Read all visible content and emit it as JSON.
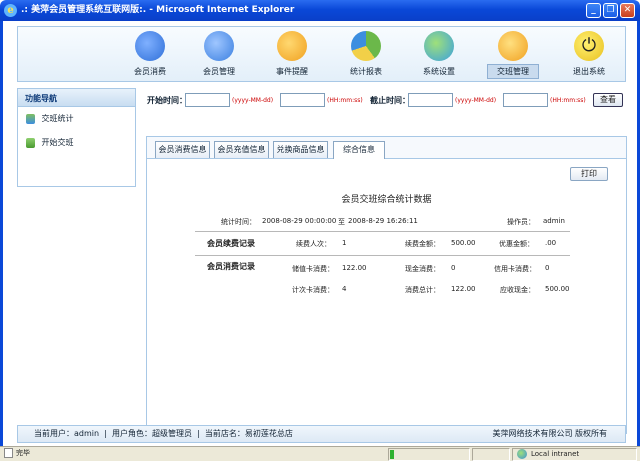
{
  "window": {
    "title": ".: 美萍会员管理系统互联网版:. - Microsoft Internet Explorer",
    "minimize": "_",
    "restore": "❐",
    "close": "✕"
  },
  "colors": {
    "titlebar": "#0a48d8",
    "accent": "#1a5fc7",
    "hint_red": "#cc0000",
    "panel_border": "#a8c8e6"
  },
  "nav": {
    "items": [
      {
        "label": "会员消费",
        "icon": "users-coin-icon",
        "color": "#2f6fd8"
      },
      {
        "label": "会员管理",
        "icon": "users-icon",
        "color": "#3a7fe0"
      },
      {
        "label": "事件提醒",
        "icon": "chat-bubbles-icon",
        "color": "#f0a020"
      },
      {
        "label": "统计报表",
        "icon": "pie-chart-icon",
        "color": "#6bb84a"
      },
      {
        "label": "系统设置",
        "icon": "globe-settings-icon",
        "color": "#3aa0e0"
      },
      {
        "label": "交班管理",
        "icon": "refresh-arrow-icon",
        "color": "#f0a020",
        "active": true
      },
      {
        "label": "退出系统",
        "icon": "power-icon",
        "color": "#e8c020"
      }
    ]
  },
  "sidebar": {
    "title": "功能导航",
    "items": [
      {
        "label": "交班统计",
        "icon": "users-small-icon"
      },
      {
        "label": "开始交班",
        "icon": "arrow-swap-icon"
      }
    ]
  },
  "filter": {
    "start_label": "开始时间：",
    "start_date": "",
    "date_hint1": "(yyyy-MM-dd)",
    "start_time": "",
    "time_hint1": "(HH:mm:ss)",
    "end_label": "截止时间：",
    "end_date": "",
    "date_hint2": "(yyyy-MM-dd)",
    "end_time": "",
    "time_hint2": "(HH:mm:ss)",
    "search_label": "查看"
  },
  "tabs": [
    {
      "label": "会员消费信息"
    },
    {
      "label": "会员充值信息"
    },
    {
      "label": "兑换商品信息"
    },
    {
      "label": "综合信息",
      "active": true
    }
  ],
  "report": {
    "print_label": "打印",
    "title": "会员交班综合统计数据",
    "time_label": "统计时间：",
    "time_start": "2008-08-29 00:00:00",
    "time_to": "至",
    "time_end": "2008-8-29 16:26:11",
    "operator_label": "操作员：",
    "operator": "admin",
    "section1": {
      "title": "会员续费记录",
      "renew_count_label": "续费人次：",
      "renew_count": "1",
      "renew_amount_label": "续费金额：",
      "renew_amount": "500.00",
      "discount_label": "优惠金额：",
      "discount": ".00"
    },
    "section2": {
      "title": "会员消费记录",
      "card_label": "储值卡消费：",
      "card": "122.00",
      "cash_label": "现金消费：",
      "cash": "0",
      "credit_label": "信用卡消费：",
      "credit": "0",
      "count_card_label": "计次卡消费：",
      "count_card": "4",
      "total_label": "消费总计：",
      "total": "122.00",
      "receivable_label": "应收现金：",
      "receivable": "500.00"
    }
  },
  "footer": {
    "user": "当前用户：admin",
    "sep1": "|",
    "role": "用户角色：超级管理员",
    "sep2": "|",
    "shop": "当前店名：易初莲花总店",
    "company": "美萍网络技术有限公司  版权所有"
  },
  "ie_status": {
    "text": "完毕",
    "zone": "Local intranet"
  }
}
